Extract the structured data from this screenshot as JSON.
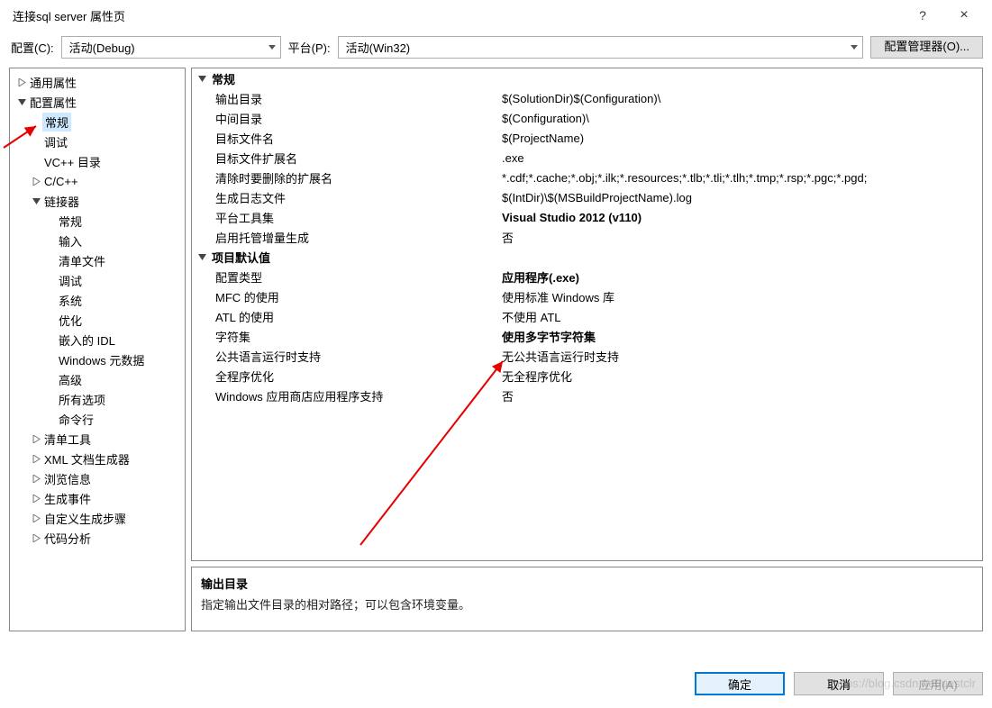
{
  "window": {
    "title": "连接sql server 属性页",
    "help": "?",
    "close": "×"
  },
  "toolbar": {
    "config_label": "配置(C):",
    "config_value": "活动(Debug)",
    "platform_label": "平台(P):",
    "platform_value": "活动(Win32)",
    "config_manager": "配置管理器(O)..."
  },
  "tree": {
    "i0": "通用属性",
    "i1": "配置属性",
    "i2": "常规",
    "i3": "调试",
    "i4": "VC++ 目录",
    "i5": "C/C++",
    "i6": "链接器",
    "i7": "常规",
    "i8": "输入",
    "i9": "清单文件",
    "i10": "调试",
    "i11": "系统",
    "i12": "优化",
    "i13": "嵌入的 IDL",
    "i14": "Windows 元数据",
    "i15": "高级",
    "i16": "所有选项",
    "i17": "命令行",
    "i18": "清单工具",
    "i19": "XML 文档生成器",
    "i20": "浏览信息",
    "i21": "生成事件",
    "i22": "自定义生成步骤",
    "i23": "代码分析"
  },
  "props": {
    "group1": "常规",
    "group2": "项目默认值",
    "r1": {
      "name": "输出目录",
      "value": "$(SolutionDir)$(Configuration)\\"
    },
    "r2": {
      "name": "中间目录",
      "value": "$(Configuration)\\"
    },
    "r3": {
      "name": "目标文件名",
      "value": "$(ProjectName)"
    },
    "r4": {
      "name": "目标文件扩展名",
      "value": ".exe"
    },
    "r5": {
      "name": "清除时要删除的扩展名",
      "value": "*.cdf;*.cache;*.obj;*.ilk;*.resources;*.tlb;*.tli;*.tlh;*.tmp;*.rsp;*.pgc;*.pgd;"
    },
    "r6": {
      "name": "生成日志文件",
      "value": "$(IntDir)\\$(MSBuildProjectName).log"
    },
    "r7": {
      "name": "平台工具集",
      "value": "Visual Studio 2012 (v110)"
    },
    "r8": {
      "name": "启用托管增量生成",
      "value": "否"
    },
    "r9": {
      "name": "配置类型",
      "value": "应用程序(.exe)"
    },
    "r10": {
      "name": "MFC 的使用",
      "value": "使用标准 Windows 库"
    },
    "r11": {
      "name": "ATL 的使用",
      "value": "不使用 ATL"
    },
    "r12": {
      "name": "字符集",
      "value": "使用多字节字符集"
    },
    "r13": {
      "name": "公共语言运行时支持",
      "value": "无公共语言运行时支持"
    },
    "r14": {
      "name": "全程序优化",
      "value": "无全程序优化"
    },
    "r15": {
      "name": "Windows 应用商店应用程序支持",
      "value": "否"
    }
  },
  "description": {
    "title": "输出目录",
    "text": "指定输出文件目录的相对路径；可以包含环境变量。"
  },
  "buttons": {
    "ok": "确定",
    "cancel": "取消",
    "apply": "应用(A)"
  },
  "watermark": "https://blog.csdn.net/uestclr"
}
